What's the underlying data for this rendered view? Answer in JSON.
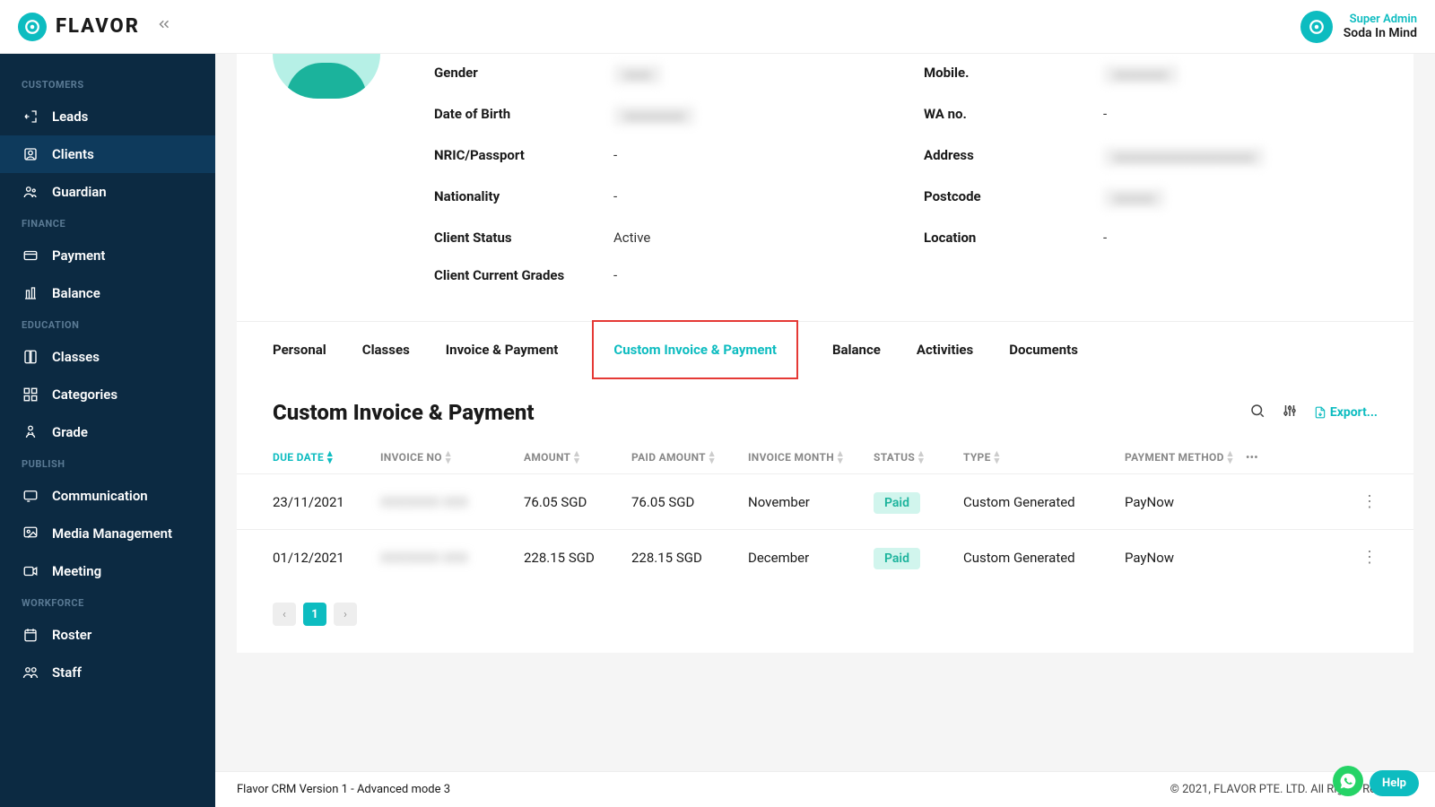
{
  "brand": {
    "name": "FLAVOR"
  },
  "user": {
    "role": "Super Admin",
    "name": "Soda In Mind"
  },
  "sidebar": {
    "sections": [
      {
        "label": "CUSTOMERS",
        "items": [
          {
            "label": "Leads",
            "icon": "leads"
          },
          {
            "label": "Clients",
            "icon": "clients",
            "active": true
          },
          {
            "label": "Guardian",
            "icon": "guardian"
          }
        ]
      },
      {
        "label": "FINANCE",
        "items": [
          {
            "label": "Payment",
            "icon": "payment"
          },
          {
            "label": "Balance",
            "icon": "balance"
          }
        ]
      },
      {
        "label": "EDUCATION",
        "items": [
          {
            "label": "Classes",
            "icon": "classes"
          },
          {
            "label": "Categories",
            "icon": "categories"
          },
          {
            "label": "Grade",
            "icon": "grade"
          }
        ]
      },
      {
        "label": "PUBLISH",
        "items": [
          {
            "label": "Communication",
            "icon": "communication"
          },
          {
            "label": "Media Management",
            "icon": "media"
          },
          {
            "label": "Meeting",
            "icon": "meeting"
          }
        ]
      },
      {
        "label": "WORKFORCE",
        "items": [
          {
            "label": "Roster",
            "icon": "roster"
          },
          {
            "label": "Staff",
            "icon": "staff"
          }
        ]
      }
    ]
  },
  "profile": {
    "left": [
      {
        "label": "Gender",
        "value": "xxxx",
        "blurred": true
      },
      {
        "label": "Date of Birth",
        "value": "xxxxxxxxx",
        "blurred": true
      },
      {
        "label": "NRIC/Passport",
        "value": "-"
      },
      {
        "label": "Nationality",
        "value": "-"
      },
      {
        "label": "Client Status",
        "value": "Active"
      },
      {
        "label": "Client Current Grades",
        "value": "-"
      }
    ],
    "right": [
      {
        "label": "Mobile.",
        "value": "xxxxxxxx",
        "blurred": true
      },
      {
        "label": "WA no.",
        "value": "-"
      },
      {
        "label": "Address",
        "value": "xxxxxxxxxxxxxxxxxxxxx",
        "blurred": true
      },
      {
        "label": "Postcode",
        "value": "xxxxxx",
        "blurred": true
      },
      {
        "label": "Location",
        "value": "-"
      }
    ]
  },
  "tabs": [
    {
      "label": "Personal"
    },
    {
      "label": "Classes"
    },
    {
      "label": "Invoice & Payment"
    },
    {
      "label": "Custom Invoice & Payment",
      "active": true,
      "highlight": true
    },
    {
      "label": "Balance"
    },
    {
      "label": "Activities"
    },
    {
      "label": "Documents"
    }
  ],
  "section_title": "Custom Invoice & Payment",
  "export_label": "Export...",
  "table": {
    "headers": [
      "DUE DATE",
      "INVOICE NO",
      "AMOUNT",
      "PAID AMOUNT",
      "INVOICE MONTH",
      "STATUS",
      "TYPE",
      "PAYMENT METHOD"
    ],
    "rows": [
      {
        "due": "23/11/2021",
        "invoice": "XXXXXXX XXX",
        "amount": "76.05 SGD",
        "paid": "76.05 SGD",
        "month": "November",
        "status": "Paid",
        "type": "Custom Generated",
        "method": "PayNow"
      },
      {
        "due": "01/12/2021",
        "invoice": "XXXXXXX XXX",
        "amount": "228.15 SGD",
        "paid": "228.15 SGD",
        "month": "December",
        "status": "Paid",
        "type": "Custom Generated",
        "method": "PayNow"
      }
    ]
  },
  "pagination": {
    "current": "1"
  },
  "footer": {
    "version": "Flavor CRM Version 1 - Advanced mode 3",
    "copyright": "© 2021, FLAVOR PTE. LTD. All Rights Reserved."
  },
  "help_label": "Help"
}
